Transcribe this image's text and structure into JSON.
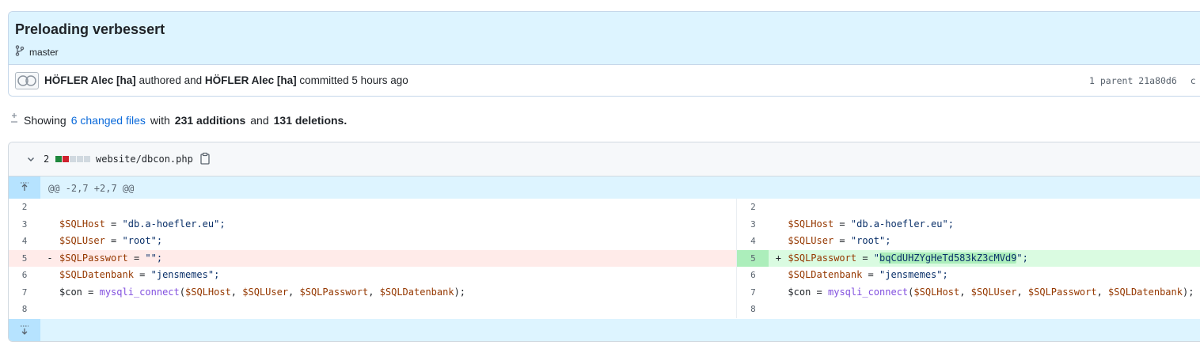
{
  "commit": {
    "title": "Preloading verbessert",
    "branch": "master",
    "author": "HÖFLER Alec [ha]",
    "authored_text": "authored and",
    "committer": "HÖFLER Alec [ha]",
    "committed_text": "committed 5 hours ago",
    "parent_text": "1 parent 21a80d6",
    "parent_trailing": "c"
  },
  "summary": {
    "prefix": "Showing",
    "changed_files": "6 changed files",
    "with": "with",
    "additions": "231 additions",
    "and": "and",
    "deletions": "131 deletions."
  },
  "file": {
    "change_count": "2",
    "filename": "website/dbcon.php",
    "diffstat_colors": [
      "#1f883d",
      "#cf222e",
      "#d1d9e0",
      "#d1d9e0",
      "#d1d9e0"
    ],
    "hunk_header": "@@ -2,7 +2,7 @@",
    "rows": [
      {
        "left_ln": "2",
        "right_ln": "2",
        "type": "ctx"
      },
      {
        "left_ln": "3",
        "right_ln": "3",
        "type": "ctx"
      },
      {
        "left_ln": "4",
        "right_ln": "4",
        "type": "ctx"
      },
      {
        "left_ln": "5",
        "right_ln": "5",
        "type": "change"
      },
      {
        "left_ln": "6",
        "right_ln": "6",
        "type": "ctx"
      },
      {
        "left_ln": "7",
        "right_ln": "7",
        "type": "ctx"
      },
      {
        "left_ln": "8",
        "right_ln": "8",
        "type": "ctx"
      }
    ],
    "code": {
      "var_host": "$SQLHost",
      "host_value": "\"db.a-hoefler.eu\";",
      "var_user": "$SQLUser",
      "user_value": "\"root\";",
      "var_pw": "$SQLPasswort",
      "pw_old": "\"\";",
      "pw_new_quote_open": "\"",
      "pw_new_value": "bqCdUHZYgHeTd583kZ3cMVd9",
      "pw_new_quote_close": "\";",
      "var_db": "$SQLDatenbank",
      "db_value": "\"jensmemes\";",
      "var_con": "$con",
      "fn": "mysqli_connect",
      "eq": "=",
      "minus": "-",
      "plus": "+"
    }
  }
}
